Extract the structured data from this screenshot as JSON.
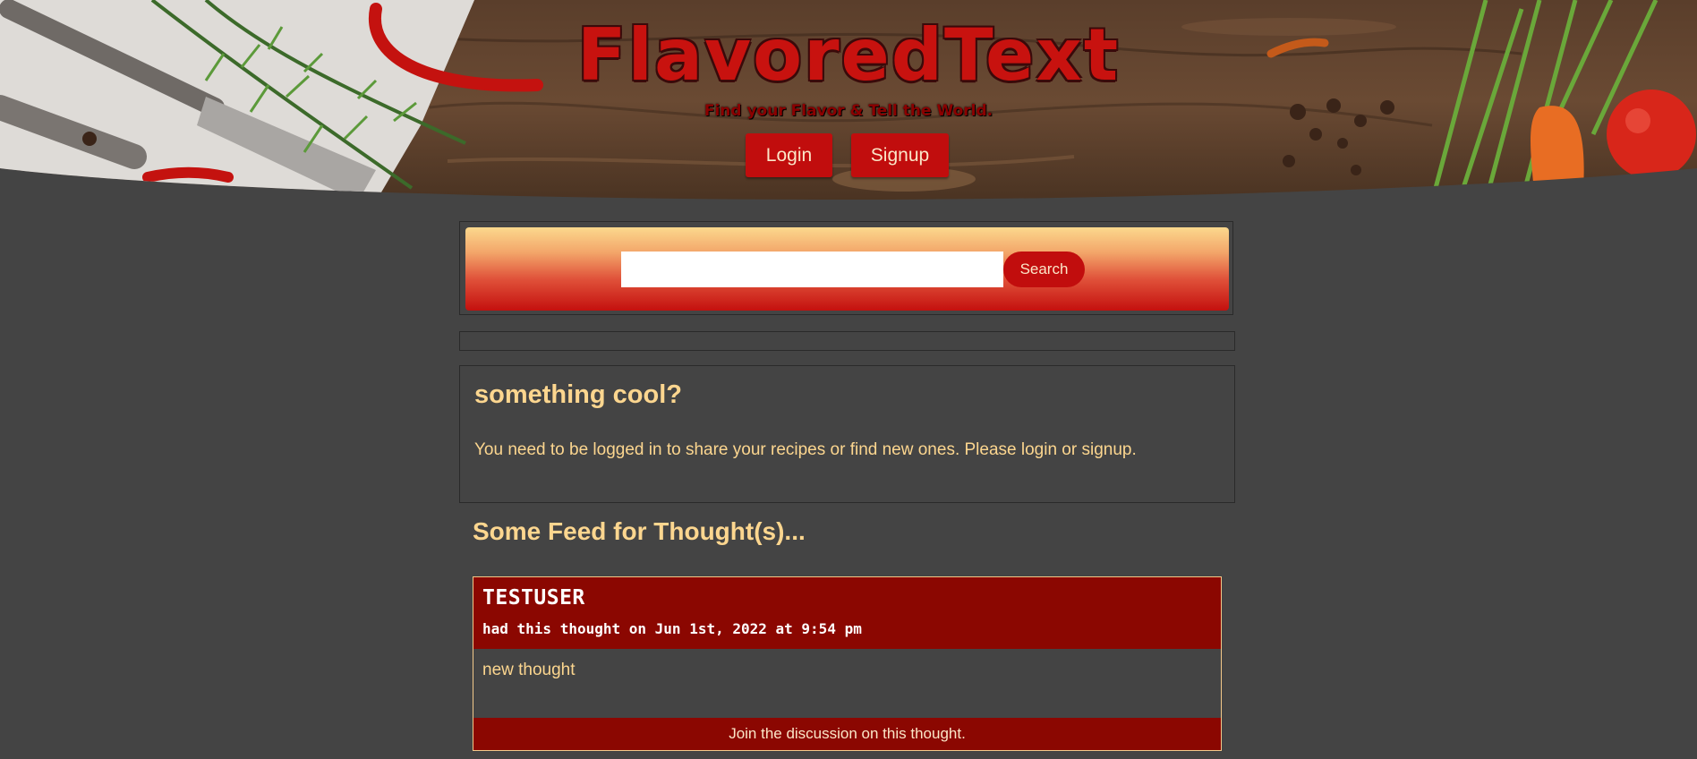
{
  "header": {
    "title": "FlavoredText",
    "tagline": "Find your Flavor & Tell the World.",
    "nav": {
      "login_label": "Login",
      "signup_label": "Signup"
    }
  },
  "search": {
    "placeholder": "",
    "value": "",
    "button_label": "Search"
  },
  "info_card": {
    "title": "something cool?",
    "message": "You need to be logged in to share your recipes or find new ones. Please login or signup."
  },
  "feed": {
    "title": "Some Feed for Thought(s)...",
    "thoughts": [
      {
        "username": "TESTUSER",
        "meta": "had this thought on Jun 1st, 2022 at 9:54 pm",
        "body": "new thought",
        "discussion_label": "Join the discussion on this thought."
      }
    ]
  },
  "colors": {
    "background": "#444444",
    "accent_red": "#c10d0d",
    "dark_red": "#8b0701",
    "text_gold": "#fcd68f"
  }
}
